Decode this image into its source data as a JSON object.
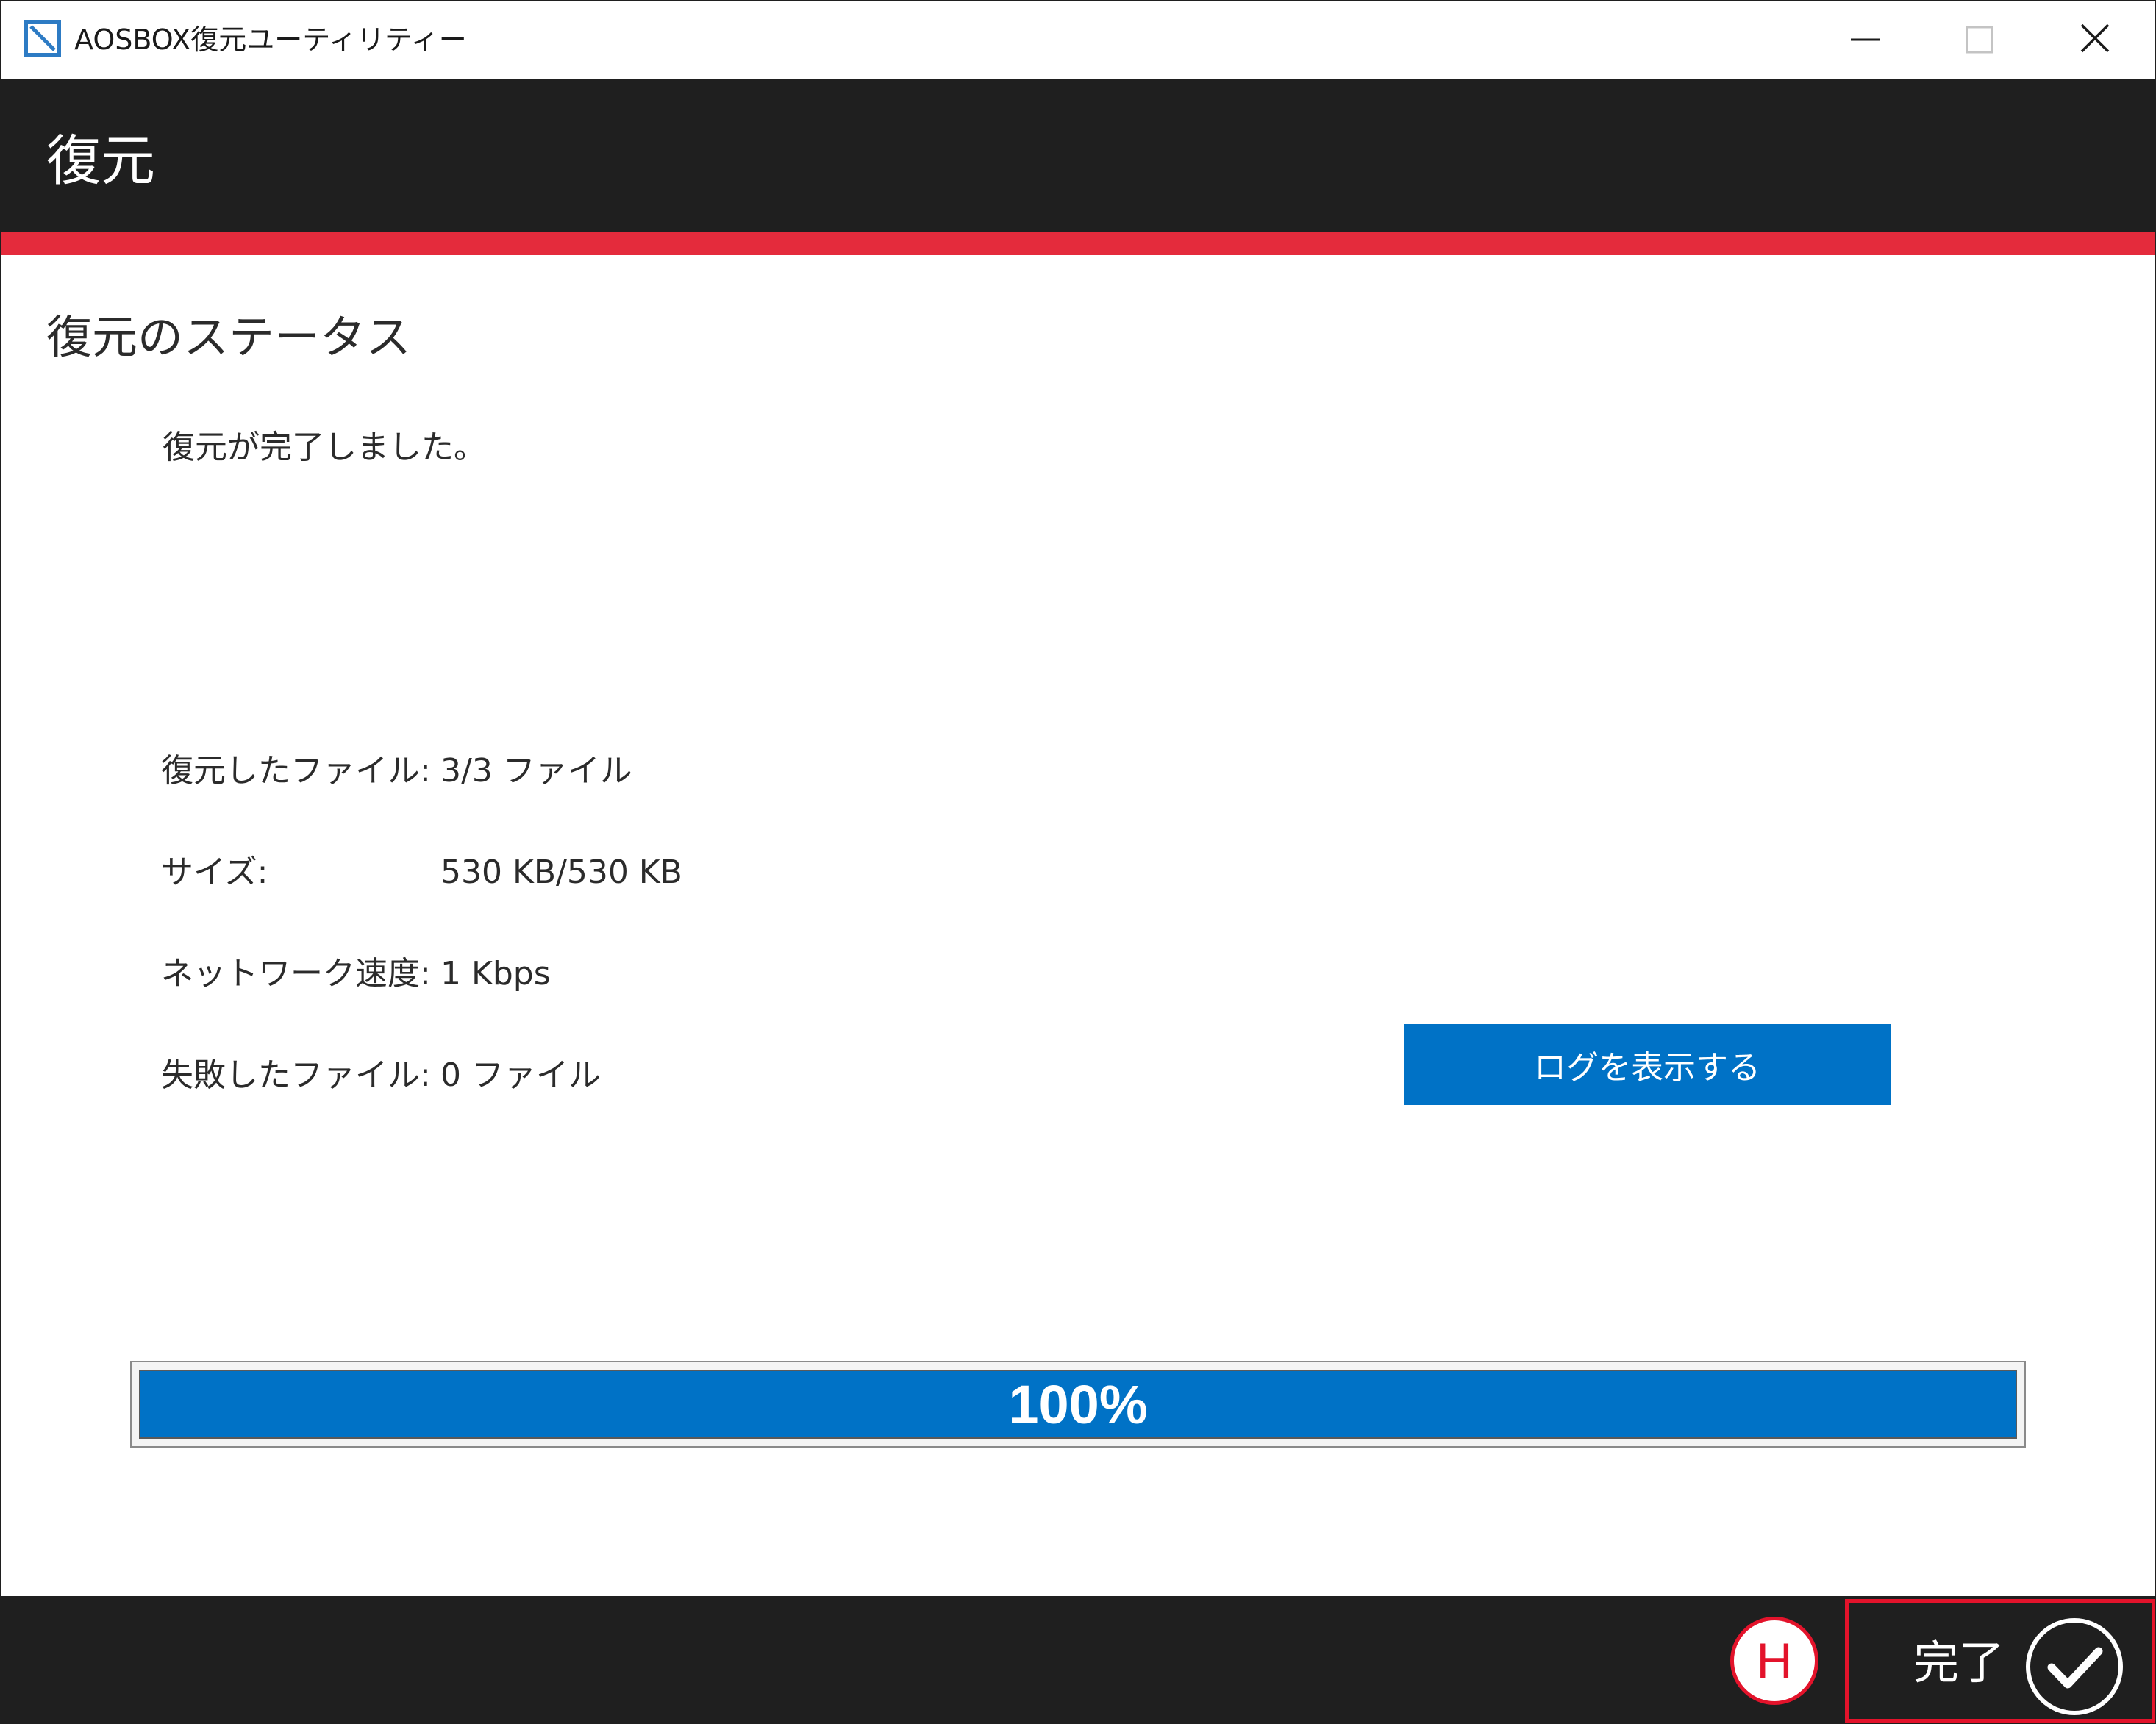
{
  "window": {
    "title": "AOSBOX復元ユーティリティー"
  },
  "header": {
    "title": "復元"
  },
  "main": {
    "section_title": "復元のステータス",
    "status_message": "復元が完了しました。",
    "stats": [
      {
        "label": "復元したファイル:",
        "value": "3/3 ファイル"
      },
      {
        "label": "サイズ:",
        "value": "530 KB/530 KB"
      },
      {
        "label": "ネットワーク速度:",
        "value": "1 Kbps"
      },
      {
        "label": "失敗したファイル:",
        "value": "0 ファイル"
      }
    ],
    "log_button_label": "ログを表示する",
    "progress": {
      "percent": 100,
      "label": "100%"
    }
  },
  "footer": {
    "marker_label": "H",
    "finish_label": "完了"
  },
  "colors": {
    "header_bg": "#1f1f1f",
    "accent": "#e42b3c",
    "primary_blue": "#0072c6",
    "annotation_red": "#e3132b"
  },
  "icons": {
    "app": "app-logo-icon",
    "minimize": "minimize-icon",
    "maximize": "maximize-icon",
    "close": "close-icon",
    "finish": "checkmark-circle-icon"
  }
}
